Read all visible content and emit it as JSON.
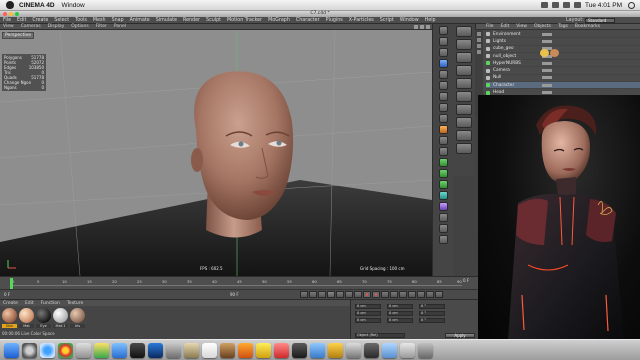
{
  "mac": {
    "app": "CINEMA 4D",
    "menu": [
      "Window"
    ],
    "clock": "Tue 4:01 PM"
  },
  "c4d": {
    "title": "C7.c4d *",
    "menu": [
      "File",
      "Edit",
      "Create",
      "Select",
      "Tools",
      "Mesh",
      "Snap",
      "Animate",
      "Simulate",
      "Render",
      "Sculpt",
      "Motion Tracker",
      "MoGraph",
      "Character",
      "Plugins",
      "X-Particles",
      "Script",
      "Window",
      "Help"
    ],
    "layout_label": "Layout:",
    "layout_value": "Standard",
    "viewport": {
      "menu": [
        "View",
        "Cameras",
        "Display",
        "Options",
        "Filter",
        "Panel"
      ],
      "label": "Perspective",
      "hud": [
        {
          "k": "Polygons",
          "v": "51778"
        },
        {
          "k": "Points",
          "v": "52072"
        },
        {
          "k": "Edges",
          "v": "103850"
        },
        {
          "k": "Tris",
          "v": "0"
        },
        {
          "k": "Quads",
          "v": "51778"
        },
        {
          "k": "Change Ngon",
          "v": "0"
        },
        {
          "k": "Ngons",
          "v": "0"
        }
      ],
      "status_left": "FPS : 602.5",
      "status_right": "Grid Spacing : 100 cm"
    },
    "objects": {
      "menu": [
        "File",
        "Edit",
        "View",
        "Objects",
        "Tags",
        "Bookmarks"
      ],
      "rows": [
        "Environment",
        "Lights",
        "cube_geo",
        "null_object",
        "HyperNURBS",
        "Camera",
        "Null",
        "Character",
        "Head",
        "Body",
        "Eyes"
      ]
    },
    "timeline": {
      "ticks": [
        "0",
        "5",
        "10",
        "15",
        "20",
        "25",
        "30",
        "35",
        "40",
        "45",
        "50",
        "55",
        "60",
        "65",
        "70",
        "75",
        "80",
        "85",
        "90"
      ],
      "end": "0 F",
      "frame_start": "0 F",
      "frame_end": "90 F"
    },
    "materials": {
      "menu": [
        "Create",
        "Edit",
        "Function",
        "Texture"
      ],
      "items": [
        "Skin",
        "Mat",
        "Eye",
        "Mat.1",
        "Iris"
      ],
      "status": "00:00:06  Live Color Space"
    },
    "coords": {
      "fields": [
        "0 cm",
        "0 cm",
        "0 cm",
        "0 cm",
        "0 cm",
        "0 cm",
        "0 °",
        "0 °",
        "0 °"
      ],
      "mode": "Object (Rel)",
      "apply": "Apply"
    }
  },
  "colors": {
    "accent": "#e5a21a",
    "viewport_bg": "#8e8e8e",
    "skin": "#b07e6c"
  }
}
